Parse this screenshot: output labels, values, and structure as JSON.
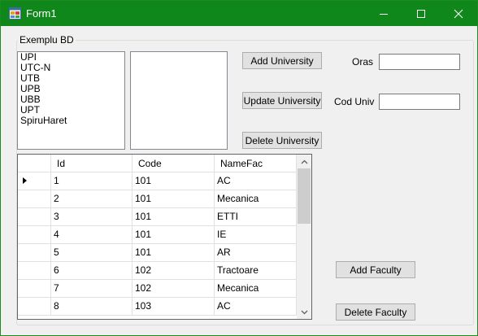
{
  "window": {
    "title": "Form1",
    "accent": "#10871b",
    "controls": {
      "minimize": "minimize-icon",
      "maximize": "maximize-icon",
      "close": "close-icon"
    }
  },
  "group": {
    "label": "Exemplu BD"
  },
  "universities": [
    "UPI",
    "UTC-N",
    "UTB",
    "UPB",
    "UBB",
    "UPT",
    "SpiruHaret"
  ],
  "faculties_list": [],
  "buttons": {
    "add_university": "Add University",
    "update_university": "Update University",
    "delete_university": "Delete University",
    "add_faculty": "Add Faculty",
    "delete_faculty": "Delete Faculty"
  },
  "fields": {
    "oras": {
      "label": "Oras",
      "value": ""
    },
    "cod_univ": {
      "label": "Cod Univ",
      "value": ""
    }
  },
  "grid": {
    "columns": [
      "Id",
      "Code",
      "NameFac"
    ],
    "current_row": 0,
    "rows": [
      [
        "1",
        "101",
        "AC"
      ],
      [
        "2",
        "101",
        "Mecanica"
      ],
      [
        "3",
        "101",
        "ETTI"
      ],
      [
        "4",
        "101",
        "IE"
      ],
      [
        "5",
        "101",
        "AR"
      ],
      [
        "6",
        "102",
        "Tractoare"
      ],
      [
        "7",
        "102",
        "Mecanica"
      ],
      [
        "8",
        "103",
        "AC"
      ]
    ]
  }
}
